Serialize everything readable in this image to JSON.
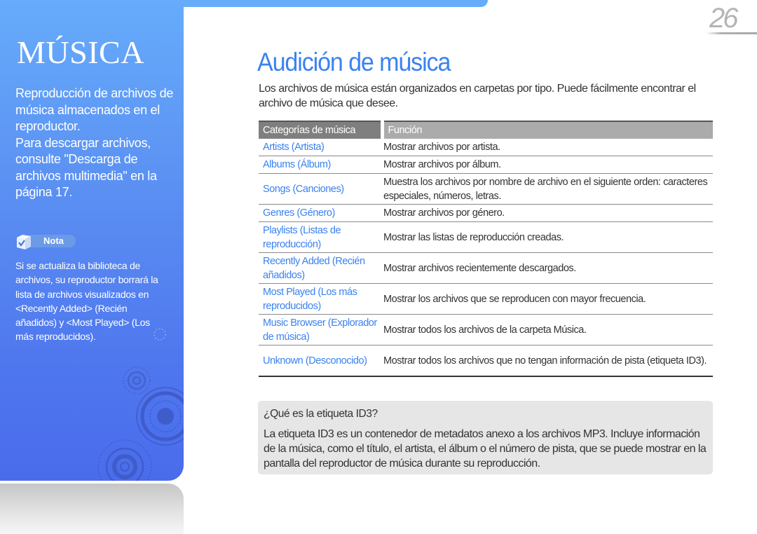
{
  "sidebar": {
    "section_title": "MÚSICA",
    "description_lines": [
      "Reproducción de archivos de música almacenados en el reproductor.",
      "Para descargar archivos, consulte \"Descarga de archivos multimedia\" en la página 17."
    ],
    "note": {
      "label": "Nota",
      "icon": "checkbox-note-icon",
      "text": "Si se actualiza la biblioteca de archivos, su reproductor borrará la lista de archivos visualizados en <Recently Added> (Recién añadidos) y <Most Played> (Los más reproducidos)."
    },
    "colors": {
      "panel_top": "#66acfb",
      "panel_bottom": "#4a6cec"
    }
  },
  "page": {
    "number": "26"
  },
  "main": {
    "title": "Audición de música",
    "intro": "Los archivos de música están organizados en carpetas por tipo. Puede fácilmente encontrar el archivo de música que desee.",
    "accent_color": "#3b82f0",
    "table": {
      "headers": [
        "Categorías de música",
        "Función"
      ],
      "rows": [
        {
          "category": "Artists (Artista)",
          "function": "Mostrar archivos por artista."
        },
        {
          "category": "Albums (Álbum)",
          "function": "Mostrar archivos por álbum."
        },
        {
          "category": "Songs (Canciones)",
          "function": "Muestra los archivos por nombre de archivo en el siguiente orden: caracteres especiales, números, letras."
        },
        {
          "category": "Genres (Género)",
          "function": "Mostrar archivos por género."
        },
        {
          "category": "Playlists (Listas de reproducción)",
          "function": "Mostrar las listas de reproducción creadas."
        },
        {
          "category": "Recently Added (Recién añadidos)",
          "function": "Mostrar archivos recientemente descargados."
        },
        {
          "category": "Most Played (Los más reproducidos)",
          "function": "Mostrar los archivos que se reproducen con mayor frecuencia."
        },
        {
          "category": "Music Browser (Explorador de música)",
          "function": "Mostrar todos los archivos de la carpeta Música."
        },
        {
          "category": "Unknown (Desconocido)",
          "function": "Mostrar todos los archivos que no tengan información de pista (etiqueta ID3)."
        }
      ]
    },
    "info_box": {
      "title": "¿Qué es la etiqueta ID3?",
      "body": "La etiqueta ID3 es un contenedor de metadatos anexo a los archivos MP3. Incluye información de la música, como el título, el artista, el álbum o el número de pista, que se puede mostrar en la pantalla del reproductor de música durante su reproducción."
    }
  }
}
